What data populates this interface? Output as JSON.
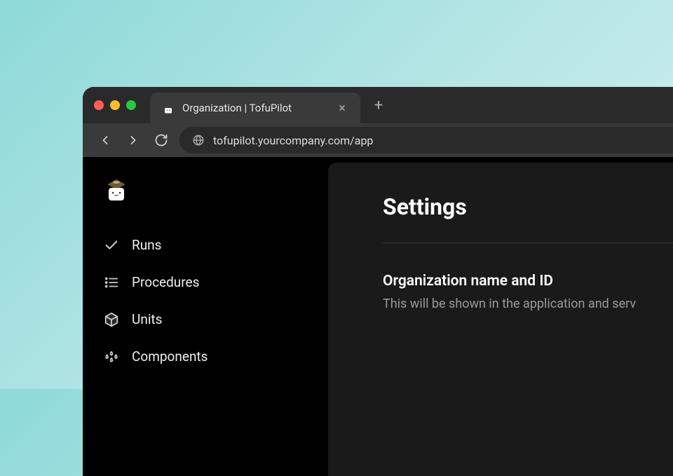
{
  "browser": {
    "tab_title": "Organization | TofuPilot",
    "url": "tofupilot.yourcompany.com/app"
  },
  "sidebar": {
    "items": [
      {
        "label": "Runs"
      },
      {
        "label": "Procedures"
      },
      {
        "label": "Units"
      },
      {
        "label": "Components"
      }
    ]
  },
  "main": {
    "title": "Settings",
    "section": {
      "heading": "Organization name and ID",
      "description": "This will be shown in the application and serv"
    }
  }
}
